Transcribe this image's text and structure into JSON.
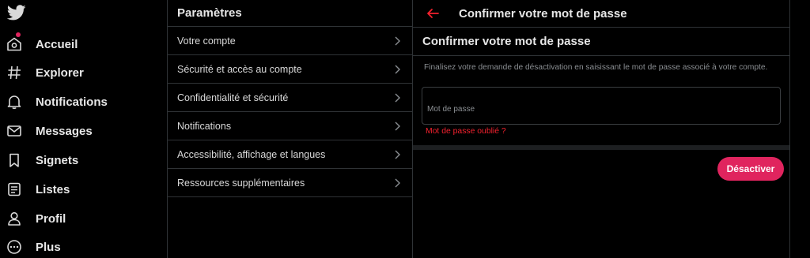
{
  "nav": {
    "items": [
      {
        "label": "Accueil",
        "icon": "home-icon"
      },
      {
        "label": "Explorer",
        "icon": "hashtag-icon"
      },
      {
        "label": "Notifications",
        "icon": "bell-icon"
      },
      {
        "label": "Messages",
        "icon": "envelope-icon"
      },
      {
        "label": "Signets",
        "icon": "bookmark-icon"
      },
      {
        "label": "Listes",
        "icon": "list-icon"
      },
      {
        "label": "Profil",
        "icon": "person-icon"
      },
      {
        "label": "Plus",
        "icon": "more-icon"
      }
    ]
  },
  "settings": {
    "title": "Paramètres",
    "items": [
      {
        "label": "Votre compte"
      },
      {
        "label": "Sécurité et accès au compte"
      },
      {
        "label": "Confidentialité et sécurité"
      },
      {
        "label": "Notifications"
      },
      {
        "label": "Accessibilité, affichage et langues"
      },
      {
        "label": "Ressources supplémentaires"
      }
    ]
  },
  "detail": {
    "header_title": "Confirmer votre mot de passe",
    "subtitle": "Confirmer votre mot de passe",
    "description": "Finalisez votre demande de désactivation en saisissant le mot de passe associé à votre compte.",
    "password_placeholder": "Mot de passe",
    "forgot_link": "Mot de passe oublié ?",
    "deactivate_label": "Désactiver"
  },
  "colors": {
    "accent": "#e0245e",
    "link_red": "#f4212e",
    "border": "#2f3336",
    "background": "#000000"
  }
}
